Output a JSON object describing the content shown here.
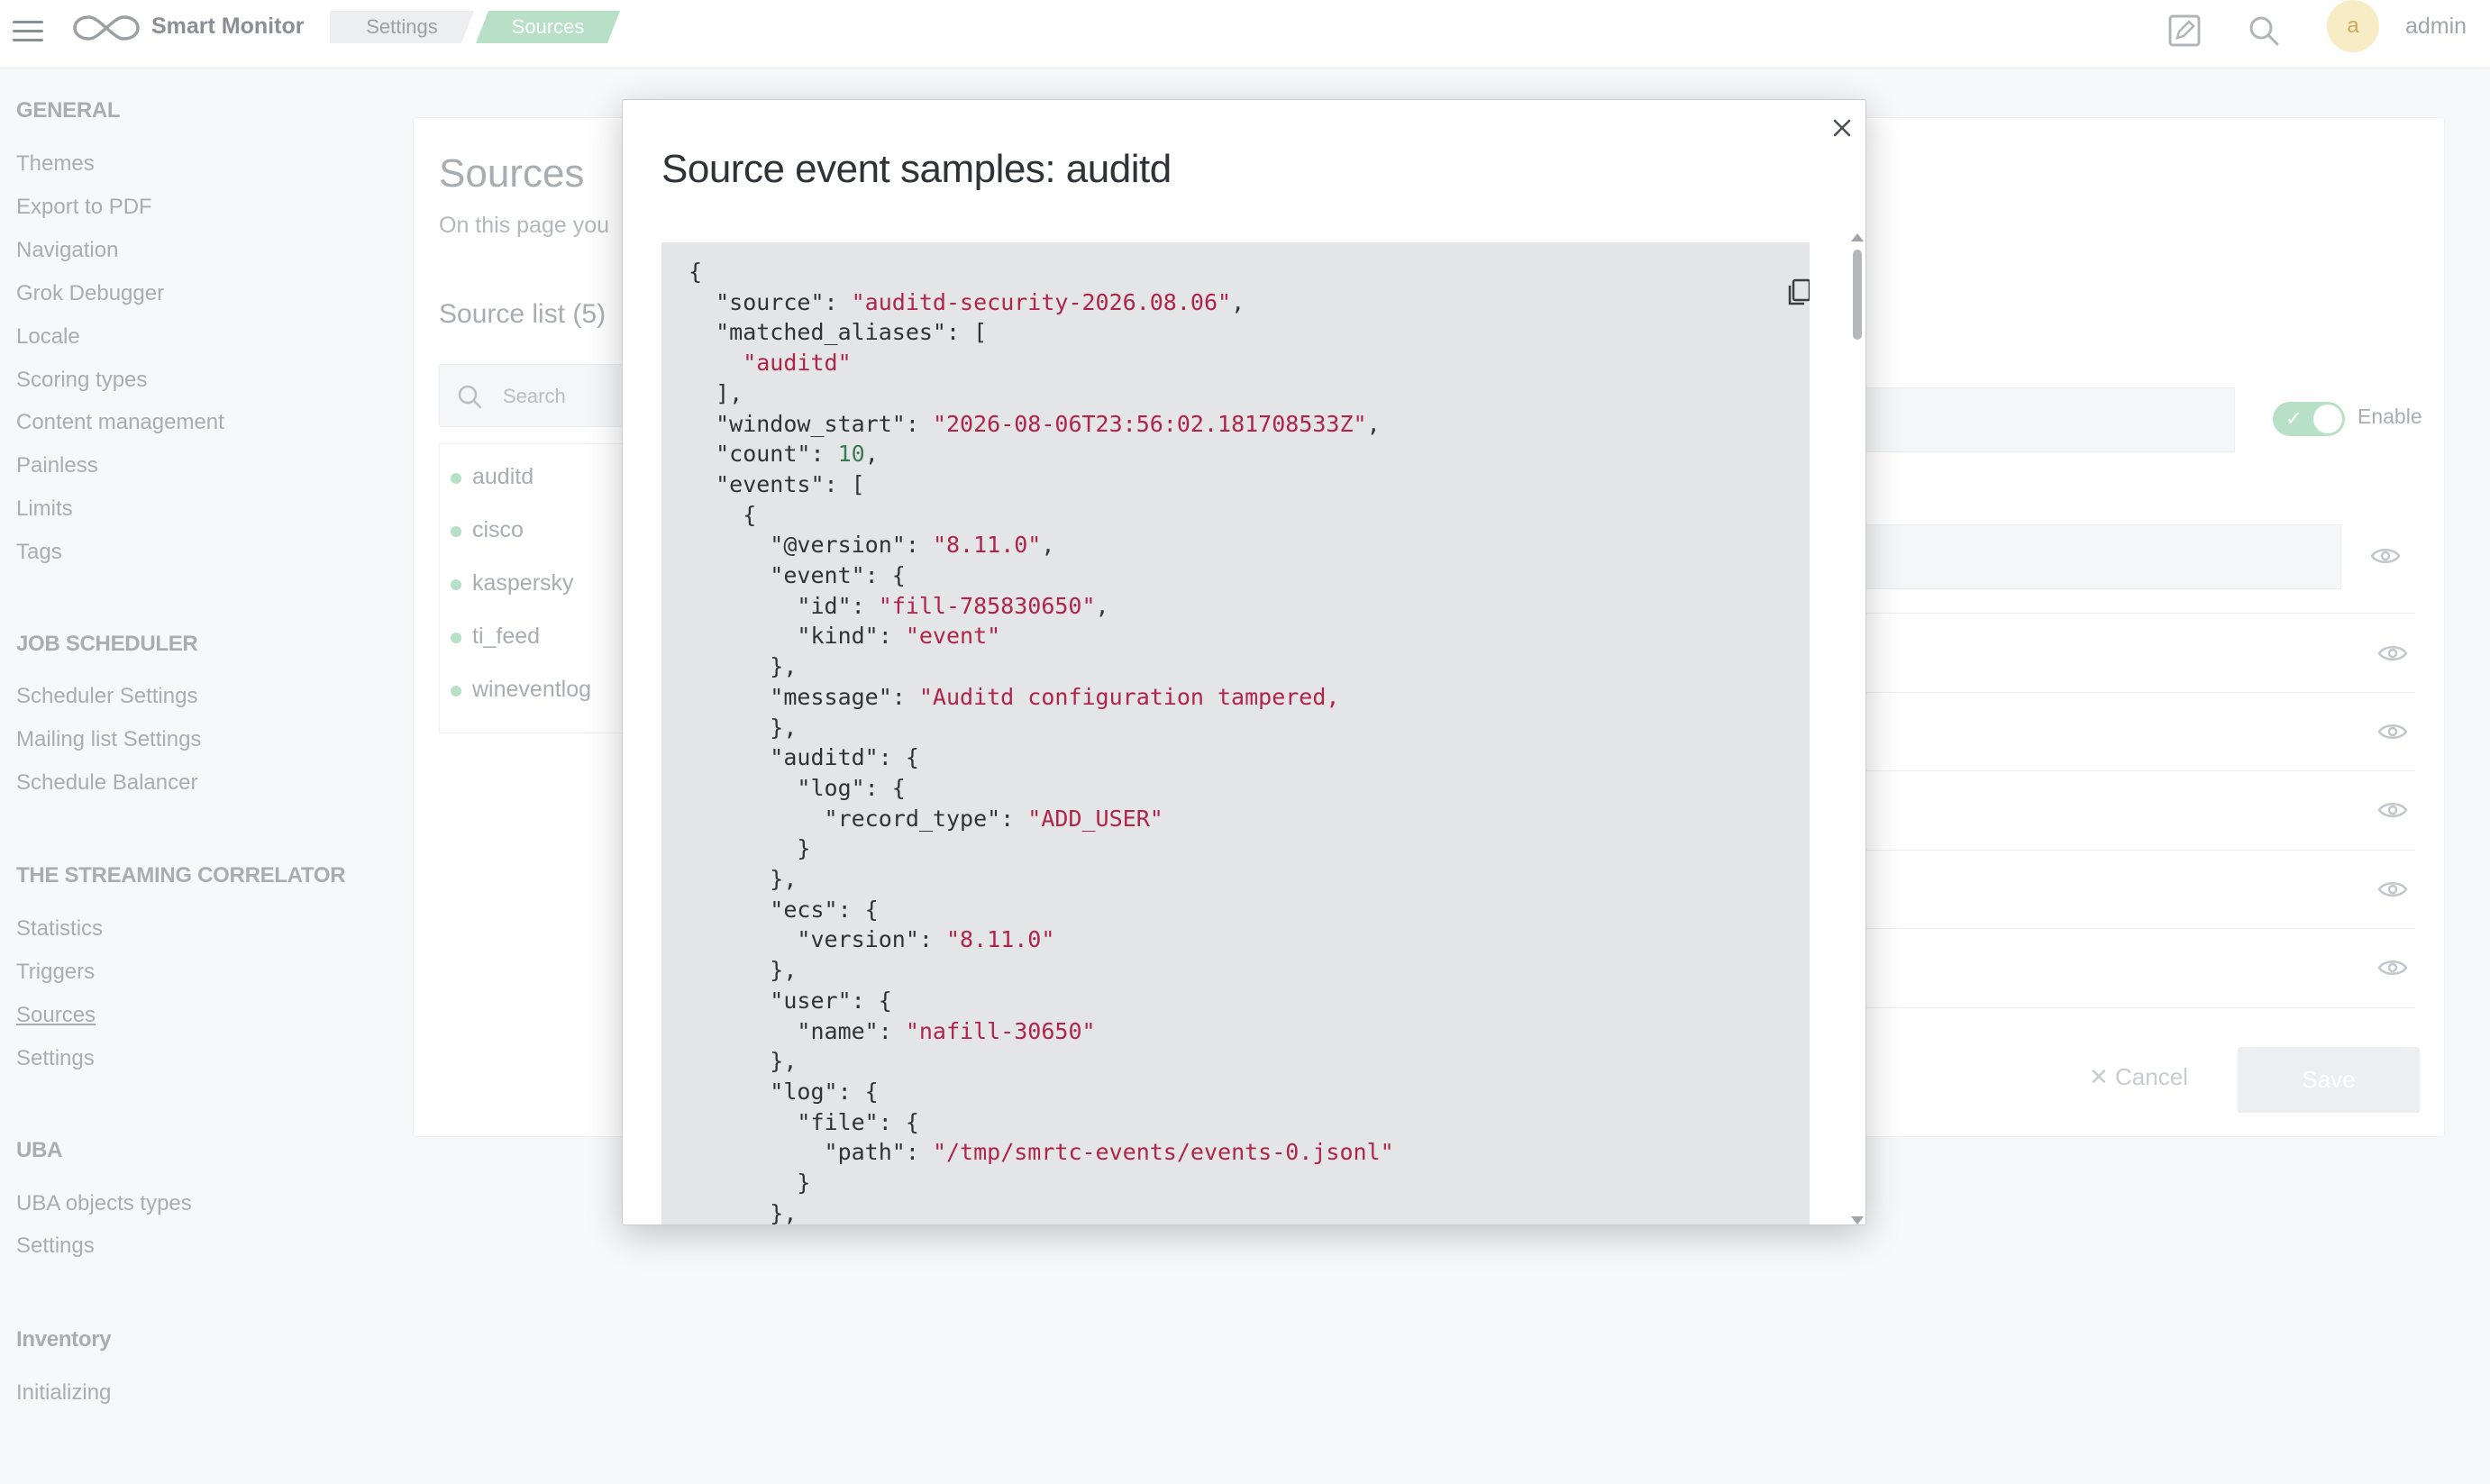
{
  "app": {
    "title": "Smart Monitor",
    "breadcrumbs": [
      "Settings",
      "Sources"
    ],
    "user": {
      "avatar_letter": "a",
      "name": "admin"
    }
  },
  "sidebar": {
    "sections": [
      {
        "title": "GENERAL",
        "items": [
          "Themes",
          "Export to PDF",
          "Navigation",
          "Grok Debugger",
          "Locale",
          "Scoring types",
          "Content management",
          "Painless",
          "Limits",
          "Tags"
        ]
      },
      {
        "title": "JOB SCHEDULER",
        "items": [
          "Scheduler Settings",
          "Mailing list Settings",
          "Schedule Balancer"
        ]
      },
      {
        "title": "THE STREAMING CORRELATOR",
        "items": [
          "Statistics",
          "Triggers",
          "Sources",
          "Settings"
        ]
      },
      {
        "title": "UBA",
        "items": [
          "UBA objects types",
          "Settings"
        ]
      },
      {
        "title": "Inventory",
        "items": [
          "Initializing"
        ]
      }
    ],
    "active_item": "Sources"
  },
  "main": {
    "heading": "Sources",
    "subtitle": "On this page you",
    "list_title": "Source list (5)",
    "search_placeholder": "Search",
    "sources": [
      "auditd",
      "cisco",
      "kaspersky",
      "ti_feed",
      "wineventlog"
    ],
    "enable_label": "Enable",
    "cancel_label": "Cancel",
    "save_label": "Save"
  },
  "modal": {
    "title": "Source event samples: auditd",
    "code_lines": [
      [
        [
          "k",
          "{"
        ]
      ],
      [
        [
          "k",
          "  \"source\": "
        ],
        [
          "s",
          "\"auditd-security-2026.08.06\""
        ],
        [
          "k",
          ","
        ]
      ],
      [
        [
          "k",
          "  \"matched_aliases\": ["
        ]
      ],
      [
        [
          "s",
          "    \"auditd\""
        ]
      ],
      [
        [
          "k",
          "  ],"
        ]
      ],
      [
        [
          "k",
          "  \"window_start\": "
        ],
        [
          "s",
          "\"2026-08-06T23:56:02.181708533Z\""
        ],
        [
          "k",
          ","
        ]
      ],
      [
        [
          "k",
          "  \"count\": "
        ],
        [
          "n",
          "10"
        ],
        [
          "k",
          ","
        ]
      ],
      [
        [
          "k",
          "  \"events\": ["
        ]
      ],
      [
        [
          "k",
          "    {"
        ]
      ],
      [
        [
          "k",
          "      \"@version\": "
        ],
        [
          "s",
          "\"8.11.0\""
        ],
        [
          "k",
          ","
        ]
      ],
      [
        [
          "k",
          "      \"event\": {"
        ]
      ],
      [
        [
          "k",
          "        \"id\": "
        ],
        [
          "s",
          "\"fill-785830650\""
        ],
        [
          "k",
          ","
        ]
      ],
      [
        [
          "k",
          "        \"kind\": "
        ],
        [
          "s",
          "\"event\""
        ]
      ],
      [
        [
          "k",
          "      },"
        ]
      ],
      [
        [
          "k",
          "      \"message\": "
        ],
        [
          "s",
          "\"Auditd configuration tampered,"
        ]
      ],
      [
        [
          "k",
          "      },"
        ]
      ],
      [
        [
          "k",
          "      \"auditd\": {"
        ]
      ],
      [
        [
          "k",
          "        \"log\": {"
        ]
      ],
      [
        [
          "k",
          "          \"record_type\": "
        ],
        [
          "s",
          "\"ADD_USER\""
        ]
      ],
      [
        [
          "k",
          "        }"
        ]
      ],
      [
        [
          "k",
          "      },"
        ]
      ],
      [
        [
          "k",
          "      \"ecs\": {"
        ]
      ],
      [
        [
          "k",
          "        \"version\": "
        ],
        [
          "s",
          "\"8.11.0\""
        ]
      ],
      [
        [
          "k",
          "      },"
        ]
      ],
      [
        [
          "k",
          "      \"user\": {"
        ]
      ],
      [
        [
          "k",
          "        \"name\": "
        ],
        [
          "s",
          "\"nafill-30650\""
        ]
      ],
      [
        [
          "k",
          "      },"
        ]
      ],
      [
        [
          "k",
          "      \"log\": {"
        ]
      ],
      [
        [
          "k",
          "        \"file\": {"
        ]
      ],
      [
        [
          "k",
          "          \"path\": "
        ],
        [
          "s",
          "\"/tmp/smrtc-events/events-0.jsonl\""
        ]
      ],
      [
        [
          "k",
          "        }"
        ]
      ],
      [
        [
          "k",
          "      },"
        ]
      ]
    ]
  },
  "colors": {
    "accent_green": "#b7e0c7",
    "code_string": "#b0234a",
    "code_number": "#3b7a55",
    "code_background": "#e4e5e6"
  },
  "icons": [
    "menu-icon",
    "logo-icon",
    "edit-icon",
    "search-icon",
    "close-icon",
    "copy-icon",
    "eye-icon",
    "check-icon"
  ]
}
